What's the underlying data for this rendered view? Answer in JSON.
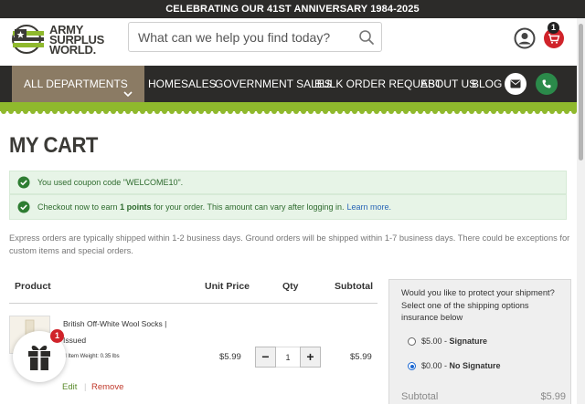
{
  "announcement": "CELEBRATING OUR 41ST ANNIVERSARY 1984-2025",
  "logo": {
    "line1": "ARMY",
    "line2": "SURPLUS",
    "line3": "WORLD."
  },
  "search": {
    "placeholder": "What can we help you find today?"
  },
  "cart_count": "1",
  "nav": {
    "departments": "ALL DEPARTMENTS",
    "links": [
      "HOME",
      "SALES",
      "GOVERNMENT SALES",
      "BULK ORDER REQUEST",
      "ABOUT US",
      "BLOG"
    ]
  },
  "page_title": "MY CART",
  "alerts": {
    "coupon": "You used coupon code \"WELCOME10\".",
    "points_pre": "Checkout now to earn ",
    "points_bold": "1 points",
    "points_post": " for your order. This amount can vary after logging in.",
    "learn_more": "Learn more."
  },
  "notice": "Express orders are typically shipped within 1-2 business days. Ground orders will be shipped within 1-7 business days. There could be exceptions for custom items and special orders.",
  "table": {
    "headers": {
      "product": "Product",
      "unit_price": "Unit Price",
      "qty": "Qty",
      "subtotal": "Subtotal"
    },
    "item": {
      "name": "British Off-White Wool Socks | Issued",
      "weight": "Total Item Weight: 0.35 lbs",
      "unit_price": "$5.99",
      "qty": "1",
      "subtotal": "$5.99",
      "edit": "Edit",
      "remove": "Remove",
      "minus": "−",
      "plus": "+"
    }
  },
  "protection": {
    "question": "Would you like to protect your shipment? Select one of the shipping options insurance below",
    "option1_price": "$5.00",
    "option1_label": "Signature",
    "option2_price": "$0.00",
    "option2_label": "No Signature",
    "selected": "No Signature",
    "subtotal_label": "Subtotal",
    "subtotal_value": "$5.99"
  },
  "gift_badge": "1",
  "colors": {
    "nav_bg": "#2c2b29",
    "dept_bg": "#8b7b64",
    "accent_green": "#8fb92d",
    "alert_bg": "#e7f4e7",
    "cart_red": "#d0232a"
  }
}
